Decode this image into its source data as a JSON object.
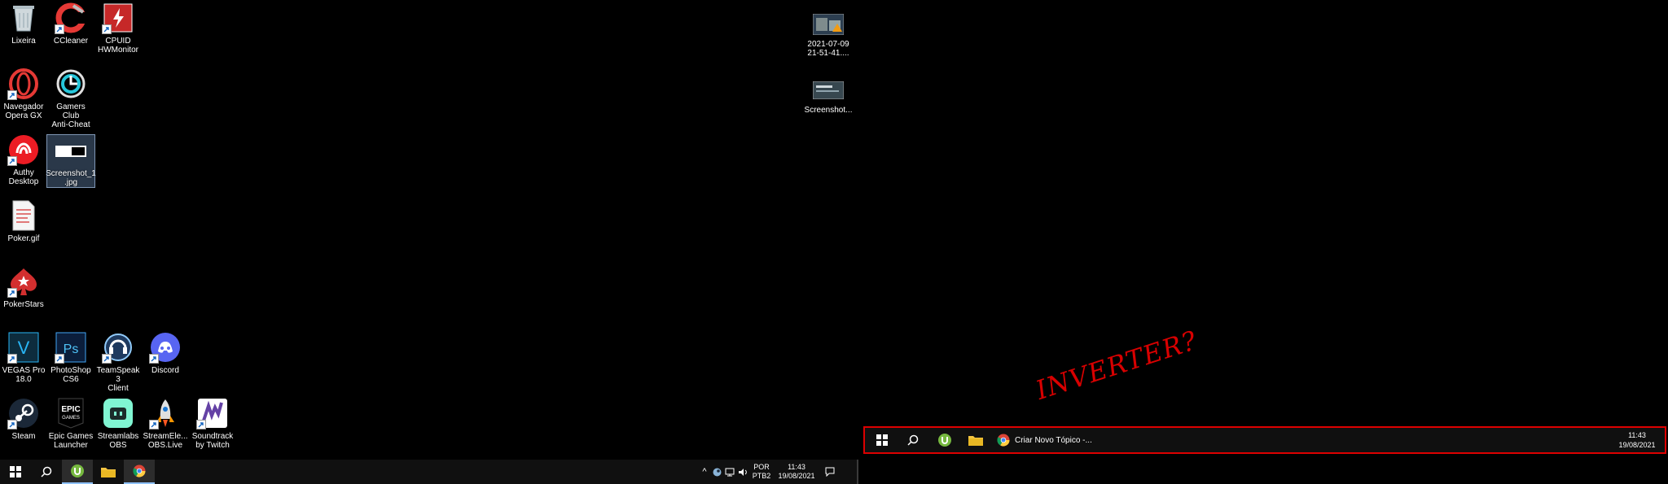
{
  "desktop": {
    "icons": [
      {
        "label_1": "Lixeira",
        "label_2": "",
        "icon": "recycle-bin-icon"
      },
      {
        "label_1": "CCleaner",
        "label_2": "",
        "icon": "ccleaner-icon"
      },
      {
        "label_1": "CPUID",
        "label_2": "HWMonitor",
        "icon": "hwmonitor-icon"
      },
      {
        "label_1": "Navegador",
        "label_2": "Opera GX",
        "icon": "opera-gx-icon"
      },
      {
        "label_1": "Gamers Club",
        "label_2": "Anti-Cheat",
        "icon": "gamers-club-icon"
      },
      {
        "label_1": "Authy",
        "label_2": "Desktop",
        "icon": "authy-icon"
      },
      {
        "label_1": "Screenshot_1",
        "label_2": ".jpg",
        "icon": "image-file-icon"
      },
      {
        "label_1": "Poker.gif",
        "label_2": "",
        "icon": "gif-file-icon"
      },
      {
        "label_1": "PokerStars",
        "label_2": "",
        "icon": "pokerstars-icon"
      },
      {
        "label_1": "VEGAS Pro",
        "label_2": "18.0",
        "icon": "vegas-pro-icon"
      },
      {
        "label_1": "PhotoShop",
        "label_2": "CS6",
        "icon": "photoshop-icon"
      },
      {
        "label_1": "TeamSpeak 3",
        "label_2": "Client",
        "icon": "teamspeak-icon"
      },
      {
        "label_1": "Discord",
        "label_2": "",
        "icon": "discord-icon"
      },
      {
        "label_1": "Steam",
        "label_2": "",
        "icon": "steam-icon"
      },
      {
        "label_1": "Epic Games",
        "label_2": "Launcher",
        "icon": "epic-games-icon"
      },
      {
        "label_1": "Streamlabs",
        "label_2": "OBS",
        "icon": "streamlabs-icon"
      },
      {
        "label_1": "StreamEle...",
        "label_2": "OBS.Live",
        "icon": "streamelements-icon"
      },
      {
        "label_1": "Soundtrack",
        "label_2": "by Twitch",
        "icon": "soundtrack-icon"
      },
      {
        "label_1": "2021-07-09",
        "label_2": "21-51-41....",
        "icon": "image-file-icon"
      },
      {
        "label_1": "Screenshot...",
        "label_2": "",
        "icon": "image-file-icon"
      }
    ]
  },
  "taskbar": {
    "items": [
      "start-button",
      "search-button",
      "utorrent-app",
      "file-explorer-app",
      "chrome-app"
    ],
    "tray": {
      "lang_1": "POR",
      "lang_2": "PTB2",
      "time": "11:43",
      "date": "19/08/2021"
    }
  },
  "proposal": {
    "chrome_title": "Criar Novo Tópico -...",
    "time": "11:43",
    "date": "19/08/2021",
    "annotation": "INVERTER?"
  },
  "colors": {
    "taskbar": "#101010",
    "annotation": "#d80000",
    "accent": "#8fc2ff"
  }
}
